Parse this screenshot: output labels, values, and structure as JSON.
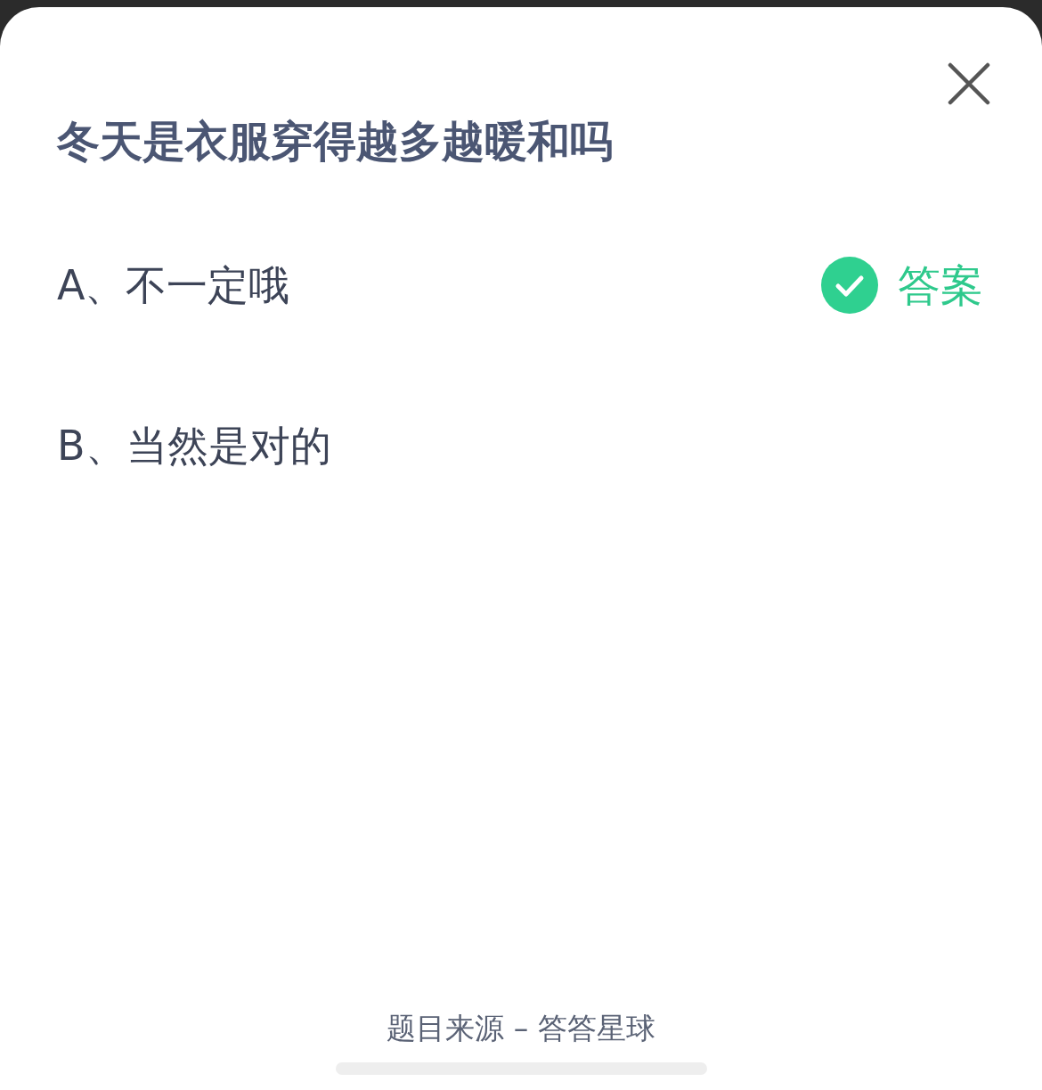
{
  "question": {
    "title": "冬天是衣服穿得越多越暖和吗"
  },
  "options": [
    {
      "text": "A、不一定哦",
      "correct": true
    },
    {
      "text": "B、当然是对的",
      "correct": false
    }
  ],
  "answer_label": "答案",
  "footer": "题目来源 – 答答星球"
}
